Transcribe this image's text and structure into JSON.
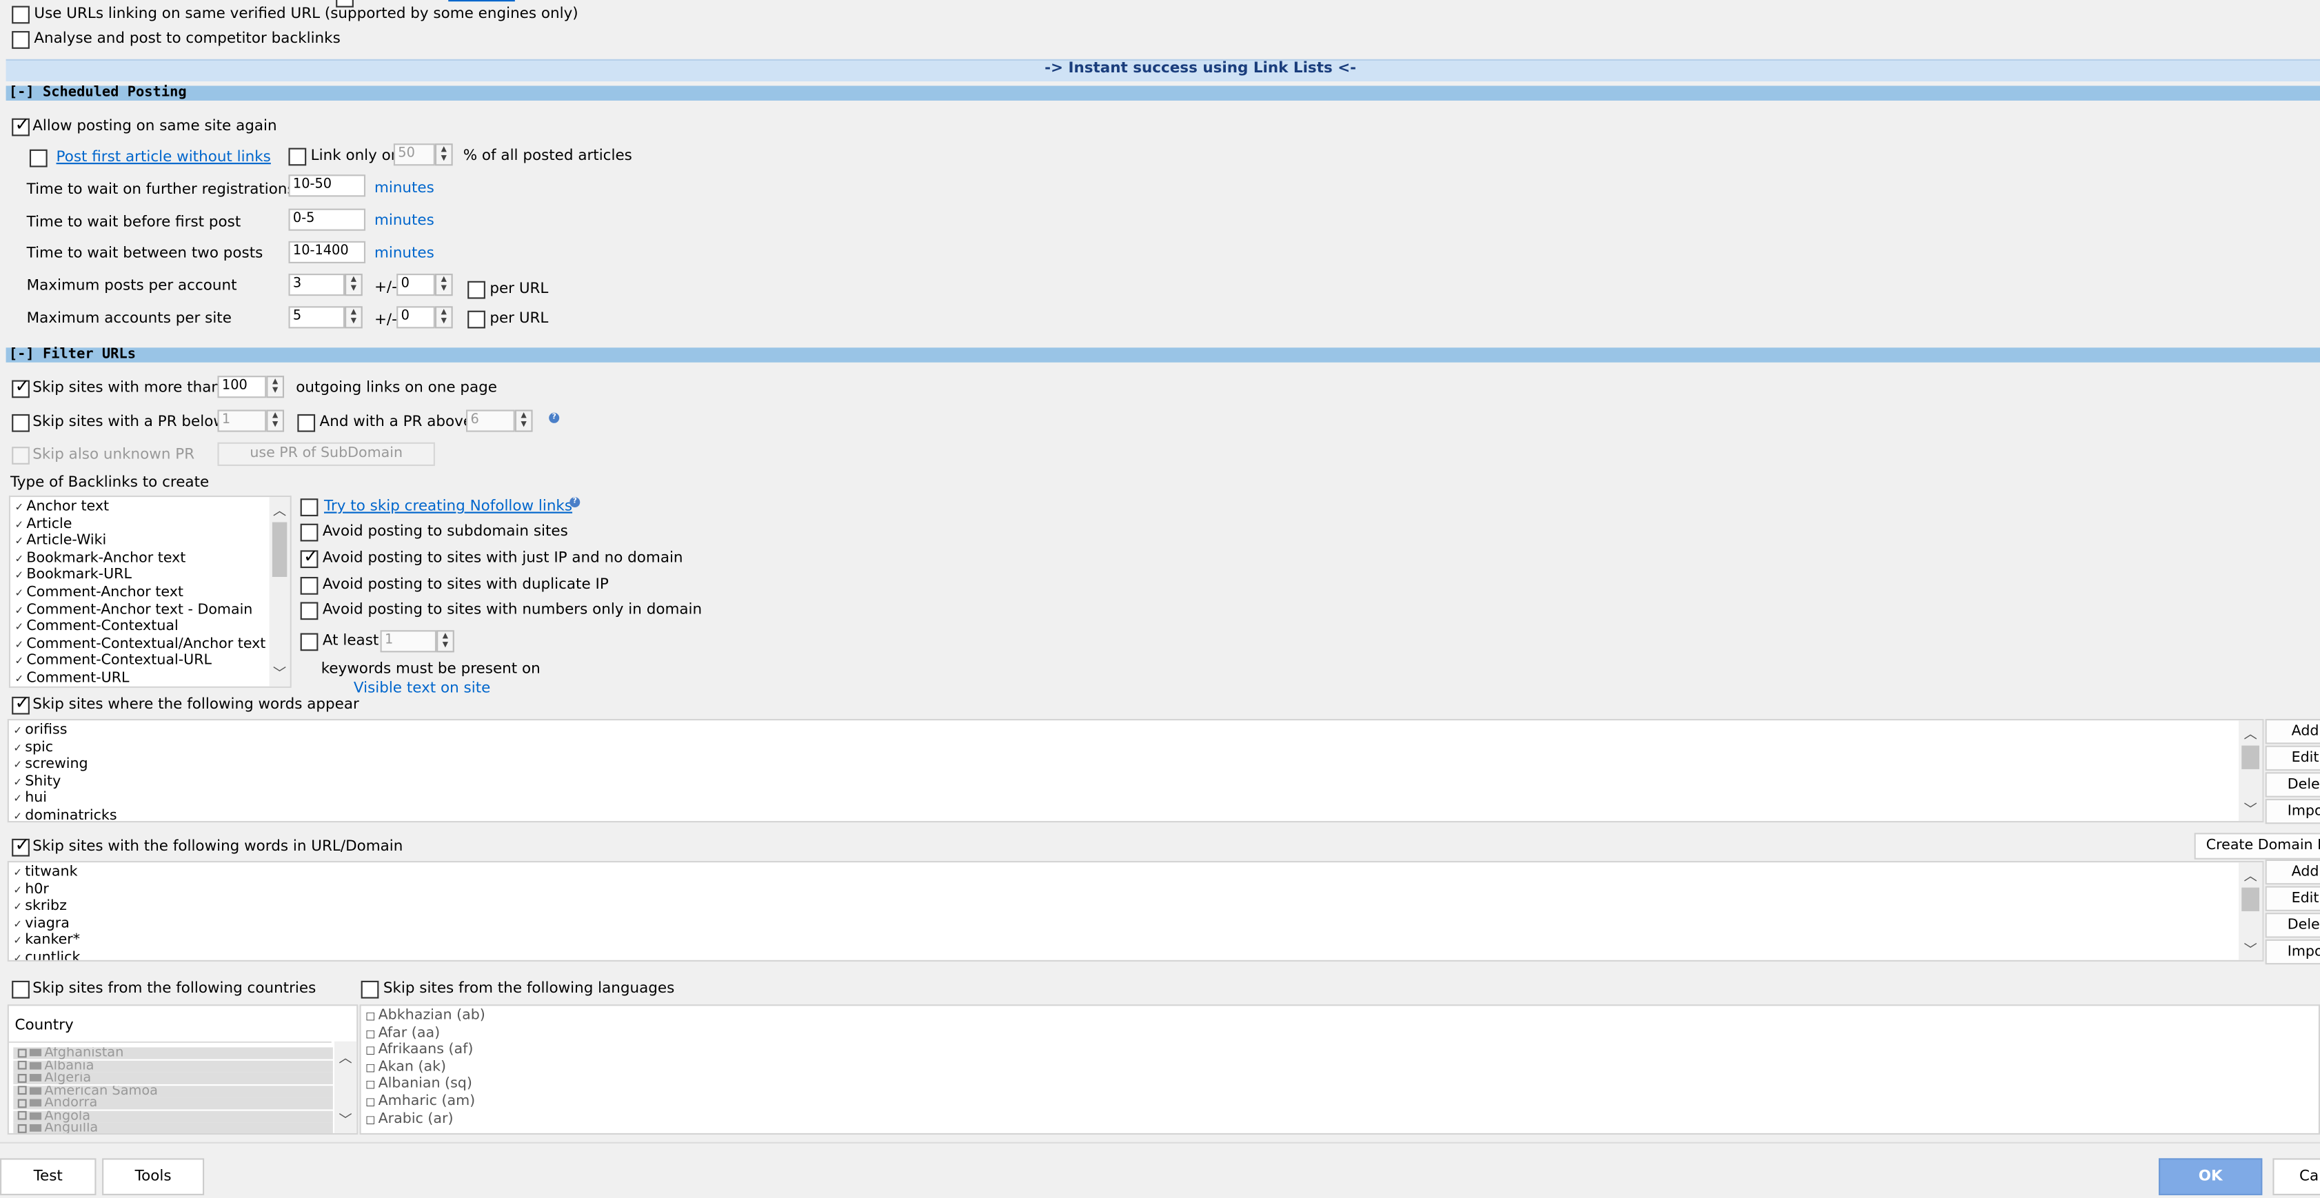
{
  "top_options": {
    "same_verified_url": "Use URLs linking on same verified URL (supported by some engines only)",
    "competitor_backlinks": "Analyse and post to competitor backlinks"
  },
  "link_lists_banner": "-> Instant success using Link Lists <-",
  "scheduled": {
    "header": "[-] Scheduled Posting",
    "allow_same_site": "Allow posting on same site again",
    "post_first_article": "Post first article without links",
    "link_only_on": "Link only on",
    "link_only_value": "50",
    "percent_label": "% of all posted articles",
    "wait_registrations_label": "Time to wait on further registrations",
    "wait_registrations_value": "10-50",
    "wait_first_post_label": "Time to wait before first post",
    "wait_first_post_value": "0-5",
    "wait_between_label": "Time to wait between two posts",
    "wait_between_value": "10-1400",
    "minutes": "minutes",
    "max_posts_label": "Maximum posts per account",
    "max_posts_value": "3",
    "max_accounts_label": "Maximum accounts per site",
    "max_accounts_value": "5",
    "plus_minus": "+/-",
    "pm_value1": "0",
    "pm_value2": "0",
    "per_url": "per URL"
  },
  "filter": {
    "header": "[-] Filter URLs",
    "skip_more_than": "Skip sites with more than",
    "outgoing_value": "100",
    "outgoing_label": "outgoing links on one page",
    "skip_pr_below": "Skip sites with a PR below",
    "pr_below_value": "1",
    "and_pr_above": "And with a PR above",
    "pr_above_value": "6",
    "skip_unknown_pr": "Skip also unknown PR",
    "use_pr_subdomain": "use PR of SubDomain",
    "type_of_backlinks": "Type of Backlinks to create",
    "backlink_types": [
      "Anchor text",
      "Article",
      "Article-Wiki",
      "Bookmark-Anchor text",
      "Bookmark-URL",
      "Comment-Anchor text",
      "Comment-Anchor text - Domain",
      "Comment-Contextual",
      "Comment-Contextual/Anchor text",
      "Comment-Contextual-URL",
      "Comment-URL"
    ],
    "try_skip_nofollow": "Try to skip creating Nofollow links",
    "avoid_subdomain": "Avoid posting to subdomain sites",
    "avoid_ip": "Avoid posting to sites with just IP and no domain",
    "avoid_duplicate_ip": "Avoid posting to sites with duplicate IP",
    "avoid_numbers": "Avoid posting to sites with numbers only in domain",
    "at_least": "At least",
    "at_least_value": "1",
    "keywords_present": "keywords must be present on",
    "visible_text": "Visible text on site",
    "skip_words_appear": "Skip sites where the following words appear",
    "words_list": [
      "orifiss",
      "spic",
      "screwing",
      "Shity",
      "hui",
      "dominatricks"
    ],
    "skip_words_url": "Skip sites with the following words in URL/Domain",
    "create_domain_filter": "Create Domain Fi",
    "url_words_list": [
      "titwank",
      "h0r",
      "skribz",
      "viagra",
      "kanker*",
      "cuntlick"
    ],
    "side_buttons": [
      "Add",
      "Edit",
      "Delete",
      "Impo"
    ],
    "skip_countries": "Skip sites from the following countries",
    "skip_languages": "Skip sites from the following languages",
    "country_header": "Country",
    "countries": [
      "Afghanistan",
      "Albania",
      "Algeria",
      "American Samoa",
      "Andorra",
      "Angola",
      "Anguilla"
    ],
    "languages": [
      "Abkhazian (ab)",
      "Afar (aa)",
      "Afrikaans (af)",
      "Akan (ak)",
      "Albanian (sq)",
      "Amharic (am)",
      "Arabic (ar)"
    ]
  },
  "footer": {
    "test": "Test",
    "tools": "Tools",
    "ok": "OK",
    "cancel": "Car"
  },
  "colors": {
    "section_header": "#99c4e6",
    "banner": "#cfe2f5",
    "ok_button": "#7faae6",
    "link": "#0066cc"
  }
}
